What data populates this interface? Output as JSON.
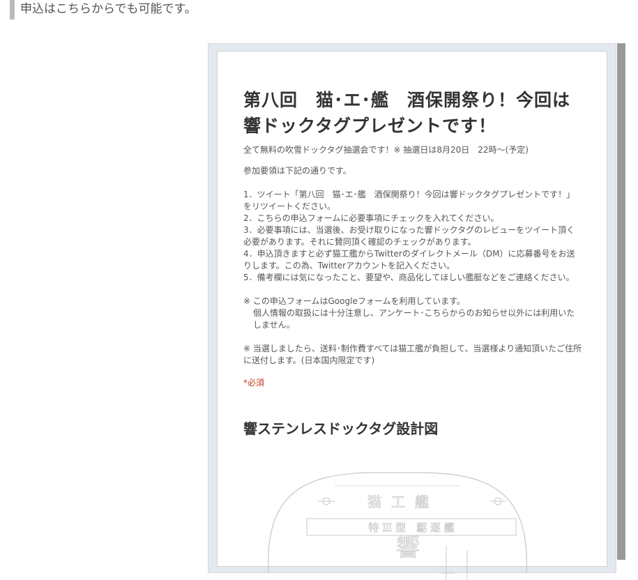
{
  "page": {
    "heading": "申込はこちらからでも可能です。"
  },
  "form": {
    "title": "第八回　猫･エ･艦　酒保開祭り！今回は響ドックタグプレゼントです！",
    "subtitle": "全て無料の吹雪ドックタグ抽選会です！※ 抽選日は8月20日　22時～(予定)",
    "intro": "参加要領は下記の通りです。",
    "steps": [
      "1．ツイート「第八回　猫･エ･艦　酒保開祭り！今回は響ドックタグプレゼントです！」をリツイートください。",
      "2．こちらの申込フォームに必要事項にチェックを入れてください。",
      "3．必要事項には、当選後、お受け取りになった響ドックタグのレビューをツイート頂く必要があります。それに賛同頂く確認のチェックがあります。",
      "4．申込頂きますと必ず猫工艦からTwitterのダイレクトメール（DM）に応募番号をお送りします。この為、Twitterアカウントを記入ください。",
      "5．備考欄には気になったこと、要望や、商品化してほしい艦艇などをご連絡ください。"
    ],
    "note1_line1": "※ この申込フォームはGoogleフォームを利用しています。",
    "note1_line2": "個人情報の取扱には十分注意し、アンケート･こちらからのお知らせ以外には利用いたしません。",
    "note2": "※ 当選しましたら、送料･制作費すべては猫工艦が負担して、当選様より通知頂いたご住所に送付します。(日本国内限定です)",
    "required": "*必須",
    "section_title": "響ステンレスドックタグ設計図"
  },
  "blueprint": {
    "top_text": "猫工艦",
    "band_text": "特 Ⅲ 型　駆 逐 艦",
    "center_text": "響"
  }
}
